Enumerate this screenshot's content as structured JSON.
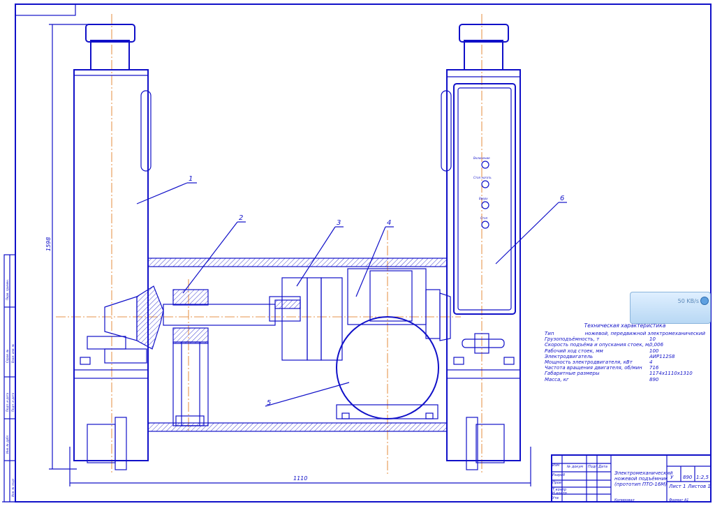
{
  "diagram": {
    "callouts": [
      "1",
      "2",
      "3",
      "4",
      "5",
      "6"
    ],
    "dimensions": {
      "height": "1598",
      "width": "1110"
    },
    "panel_labels": [
      "Включение",
      "Стоп ноготь",
      "Вверх",
      "Стоп"
    ]
  },
  "tech_spec": {
    "heading": "Техническая характеристика",
    "rows": [
      {
        "k": "Тип",
        "v": "ножевой, передвижной электромеханический"
      },
      {
        "k": "Грузоподъёмность, т",
        "v": "10"
      },
      {
        "k": "Скорость подъёма и опускания стоек, м/с",
        "v": "0,006"
      },
      {
        "k": "Рабочий ход стоек, мм",
        "v": "100"
      },
      {
        "k": "Электродвигатель",
        "v": "АИР112S8"
      },
      {
        "k": "Мощность электродвигателя, кВт",
        "v": "4"
      },
      {
        "k": "Частота вращения двигателя, об/мин",
        "v": "716"
      },
      {
        "k": "Габаритные размеры",
        "v": "1174x1110x1310"
      },
      {
        "k": "Масса, кг",
        "v": "890"
      }
    ]
  },
  "title_block": {
    "name_lines": [
      "Электромеханический",
      "ножевой подъёмник",
      "(прототип ПТО-16М)"
    ],
    "lit": "У",
    "mass": "890",
    "scale": "1:2,5",
    "sheet": "Лист 1",
    "sheets": "Листов 1",
    "row_labels": [
      "Изм",
      "Разраб",
      "Пров",
      "Т.контр",
      "Н.контр",
      "Утв"
    ],
    "col_labels": [
      "№ докум",
      "Подп",
      "Дата"
    ],
    "bottom_left": "Копировал",
    "bottom_right": "Формат А1"
  },
  "side_stamps": [
    "Перв. примен.",
    "Справ. №",
    "Подп. и дата",
    "Инв. № дубл",
    "Взам. инв. №",
    "Подп. и дата",
    "Инв. № подл"
  ],
  "speed_badge": {
    "value": "50 KB/s"
  }
}
